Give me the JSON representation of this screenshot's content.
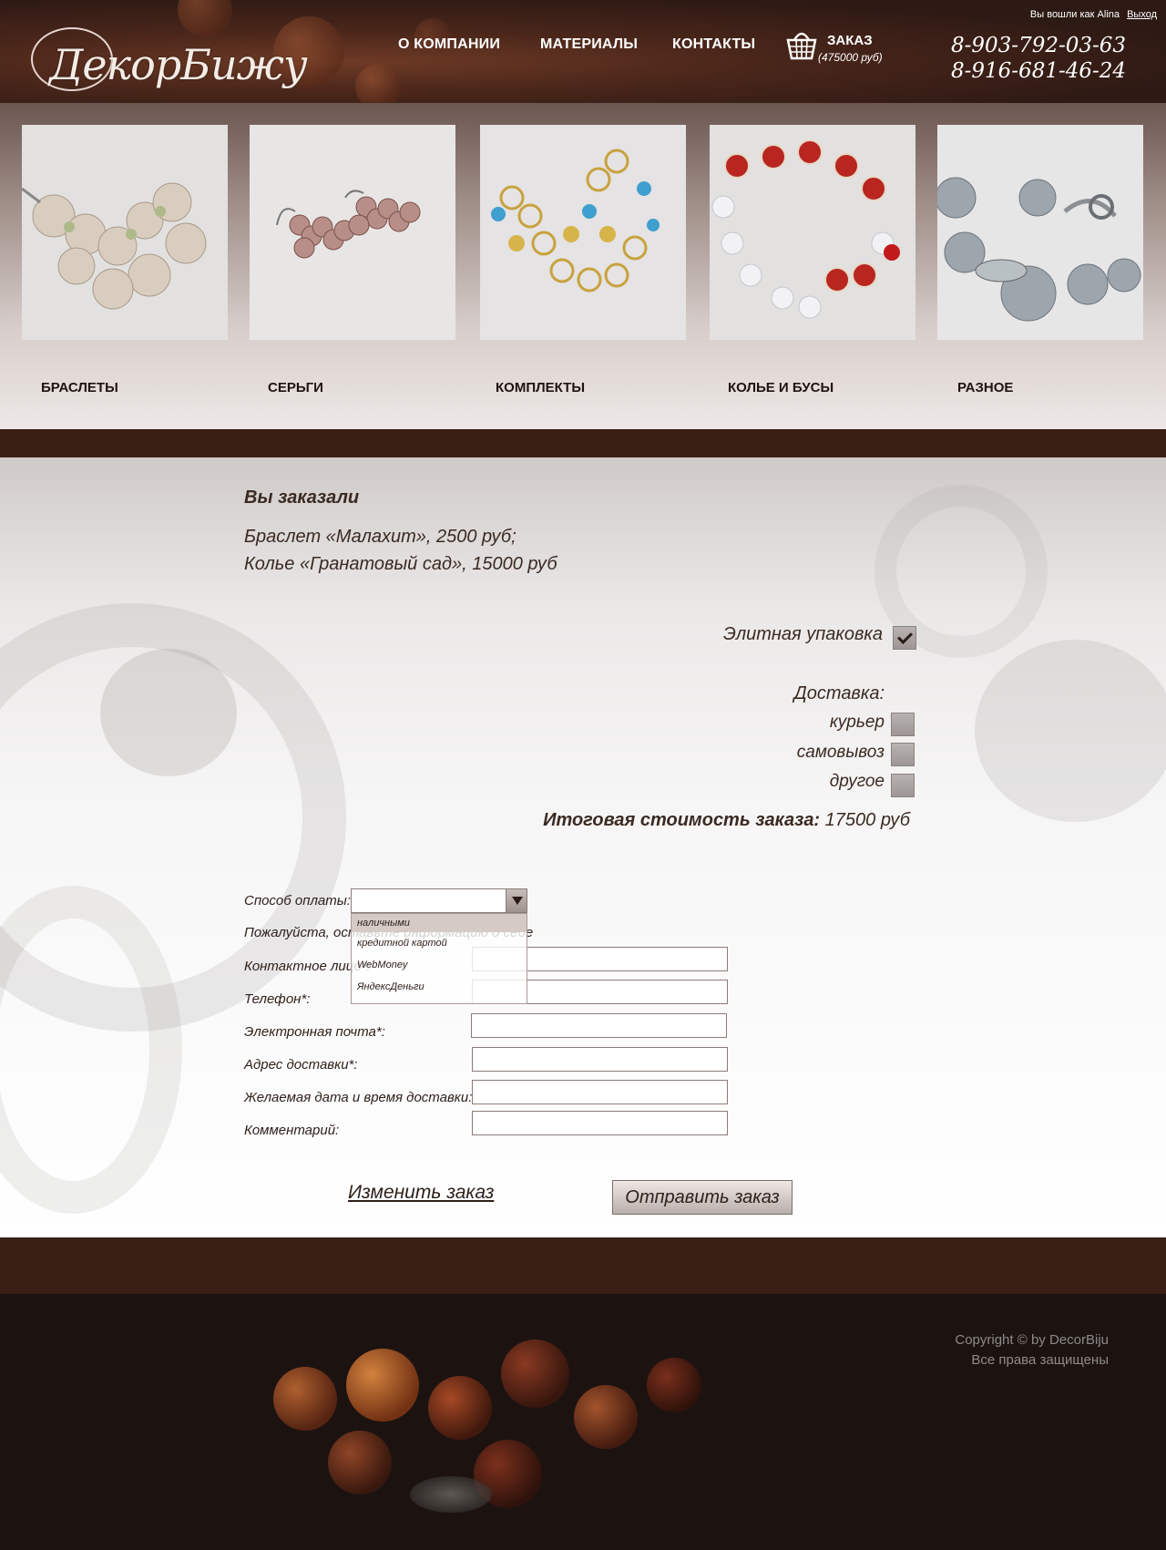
{
  "header": {
    "logo_text": "ДекорБижу",
    "nav": [
      "О КОМПАНИИ",
      "МАТЕРИАЛЫ",
      "КОНТАКТЫ"
    ],
    "cart": {
      "title": "ЗАКАЗ",
      "sum": "(475000 руб)"
    },
    "phones": [
      "8-903-792-03-63",
      "8-916-681-46-24"
    ],
    "login": {
      "text": "Вы вошли как Alina",
      "logout": "Выход"
    }
  },
  "categories": [
    {
      "label": "БРАСЛЕТЫ"
    },
    {
      "label": "СЕРЬГИ"
    },
    {
      "label": "КОМПЛЕКТЫ"
    },
    {
      "label": "КОЛЬЕ И БУСЫ"
    },
    {
      "label": "РАЗНОЕ"
    }
  ],
  "order": {
    "title": "Вы заказали",
    "items": [
      "Браслет «Малахит», 2500 руб;",
      "Колье «Гранатовый сад», 15000 руб"
    ],
    "elite_packaging": {
      "label": "Элитная упаковка",
      "checked": true
    },
    "delivery": {
      "title": "Доставка:",
      "options": [
        {
          "label": "курьер",
          "checked": false
        },
        {
          "label": "самовывоз",
          "checked": false
        },
        {
          "label": "другое",
          "checked": false
        }
      ]
    },
    "total": {
      "label": "Итоговая стоимость заказа:",
      "value": "17500 руб"
    }
  },
  "form": {
    "payment_label": "Способ оплаты:",
    "payment_value": "",
    "payment_options": [
      "наличными",
      "кредитной картой",
      "WebMoney",
      "ЯндексДеньги"
    ],
    "hint": "Пожалуйста, оставьте информацию о себе",
    "fields": [
      {
        "label": "Контактное лицо*:",
        "value": ""
      },
      {
        "label": "Телефон*:",
        "value": ""
      },
      {
        "label": "Электронная почта*:",
        "value": ""
      },
      {
        "label": "Адрес доставки*:",
        "value": ""
      },
      {
        "label": "Желаемая дата и время доставки:",
        "value": ""
      },
      {
        "label": "Комментарий:",
        "value": ""
      }
    ],
    "change_order": "Изменить заказ",
    "send_order": "Отправить заказ"
  },
  "footer": {
    "copyright": "Copyright © by DecorBiju",
    "rights": "Все права защищены"
  },
  "colors": {
    "brown_dark": "#3a1f15",
    "text": "#3a2a22",
    "footer_bg": "#1c1311"
  }
}
